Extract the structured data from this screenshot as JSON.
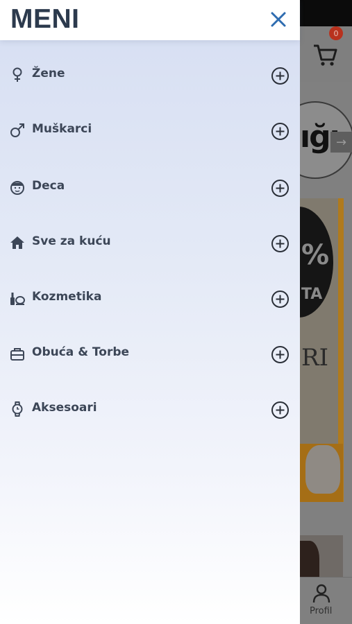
{
  "menu": {
    "title": "MENI",
    "items": [
      {
        "label": "Žene",
        "icon": "female-icon"
      },
      {
        "label": "Muškarci",
        "icon": "male-icon"
      },
      {
        "label": "Deca",
        "icon": "child-face-icon"
      },
      {
        "label": "Sve za kuću",
        "icon": "home-icon"
      },
      {
        "label": "Kozmetika",
        "icon": "cosmetics-icon"
      },
      {
        "label": "Obuća & Torbe",
        "icon": "bag-icon"
      },
      {
        "label": "Aksesoari",
        "icon": "watch-icon"
      }
    ]
  },
  "background": {
    "cart_count": "0",
    "logo_text": "ığı",
    "banner_discount": "%",
    "banner_sub": "TA",
    "banner_text": "RI",
    "bottom_nav": {
      "profile_label": "Profil"
    }
  },
  "colors": {
    "accent": "#2e6cb0",
    "menu_text": "#3c4657",
    "title_text": "#2c3a4d",
    "badge": "#b8321e"
  }
}
